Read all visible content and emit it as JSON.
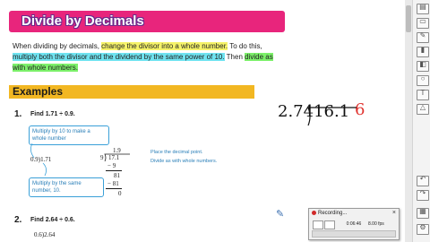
{
  "lesson": {
    "title": "Divide by Decimals",
    "intro": {
      "pre": "When dividing by decimals, ",
      "hl1": "change the divisor into a whole number.",
      "mid1": " To do this, ",
      "hl2": "multiply both the divisor and the dividend by the same power of 10.",
      "mid2": " Then ",
      "hl3": "divide as with whole numbers."
    },
    "examples_heading": "Examples",
    "example1": {
      "number": "1.",
      "problem": "Find 1.71 ÷ 0.9.",
      "callout_top": "Multiply by 10 to make a whole number",
      "callout_bottom": "Multiply by the same number, 10.",
      "setup": "0.9)1.71",
      "quotient": "1.9",
      "divisor": "9",
      "dividend": "17.1",
      "step1": "− 9",
      "step2": "81",
      "step3": "− 81",
      "remainder": "0",
      "note1": "Place the decimal point.",
      "note2": "Divide as with whole numbers."
    },
    "example2": {
      "number": "2.",
      "problem": "Find 2.64 ÷ 0.6.",
      "setup": "0.6)2.64"
    }
  },
  "handwriting": {
    "text": "2.7416.1",
    "mark": "6"
  },
  "recorder": {
    "title": "Recording...",
    "time": "0:06:46",
    "rate": "8.00 fps",
    "close": "×"
  },
  "colors": {
    "title_bg": "#e8257c",
    "examples_bg": "#f2b722",
    "highlight_yellow": "#f6f36a",
    "highlight_cyan": "#6fe3f0",
    "highlight_green": "#7cf06a",
    "callout_blue": "#2a7fb8",
    "ink_red": "#e0322e"
  },
  "toolbar_icons": [
    "document-icon",
    "page-icon",
    "pen-icon",
    "highlighter-icon",
    "eraser-icon",
    "lasso-icon",
    "text-icon",
    "shape-icon",
    "undo-icon",
    "redo-icon",
    "image-icon",
    "settings-icon"
  ]
}
